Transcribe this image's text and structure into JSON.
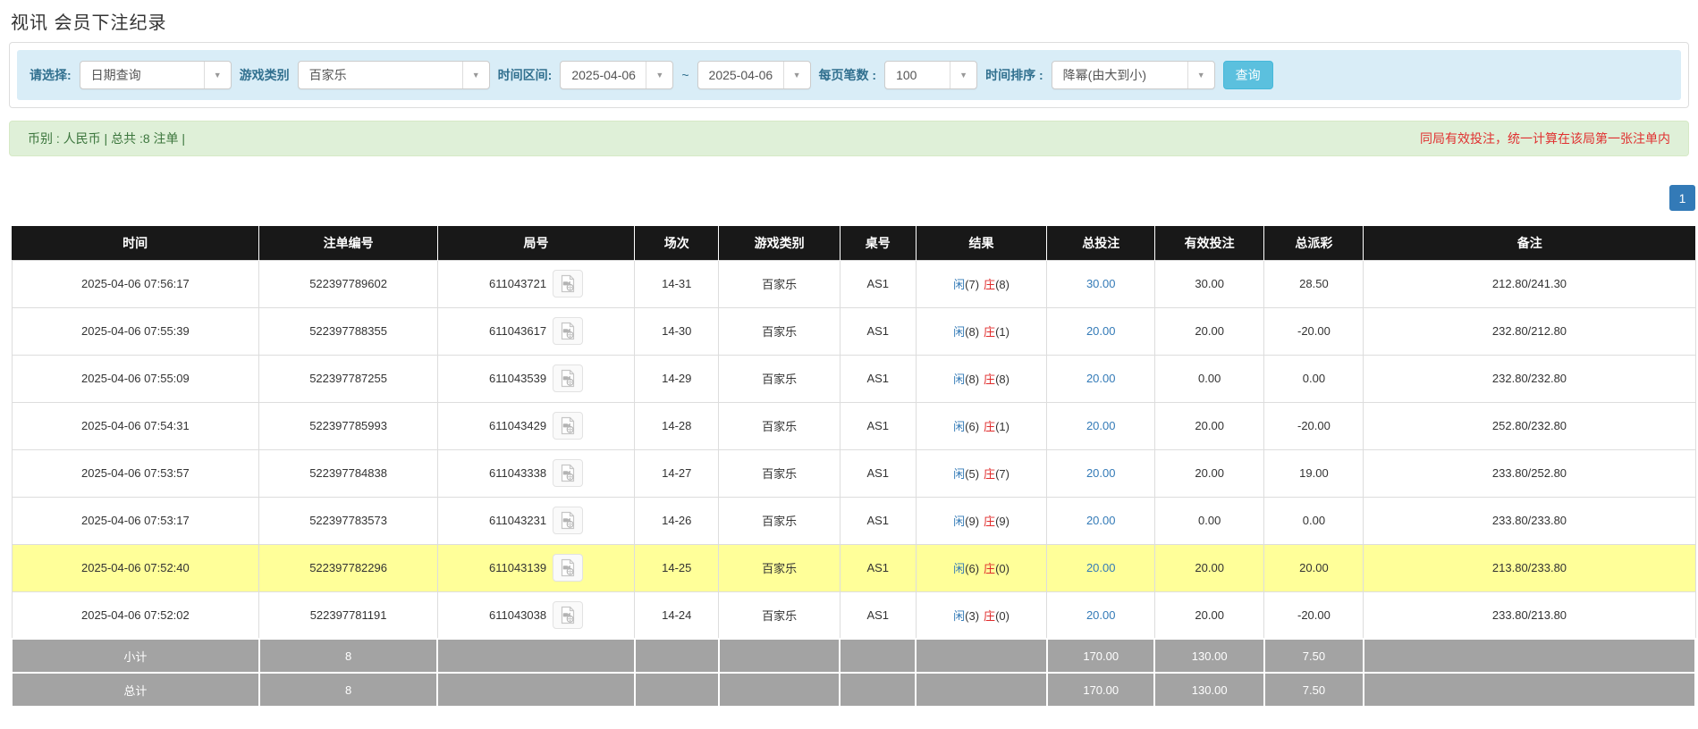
{
  "page_title": "视讯 会员下注纪录",
  "filters": {
    "query_type_label": "请选择:",
    "query_type_value": "日期查询",
    "game_type_label": "游戏类别",
    "game_type_value": "百家乐",
    "time_range_label": "时间区间:",
    "date_from": "2025-04-06",
    "tilde": "~",
    "date_to": "2025-04-06",
    "page_size_label": "每页笔数 :",
    "page_size_value": "100",
    "sort_label": "时间排序 :",
    "sort_value": "降幂(由大到小)",
    "search_button_label": "查询"
  },
  "summary_bar": {
    "left_text": "币别 : 人民币 | 总共 :8 注单 |",
    "right_text": "同局有效投注，统一计算在该局第一张注单内"
  },
  "pagination": {
    "current_page": "1"
  },
  "icons": {
    "dropdown_caret": "chevron-down-icon",
    "round_media": "video-replay-icon"
  },
  "colors": {
    "header_bg": "#181818",
    "filter_bar_bg": "#d9edf7",
    "filter_label": "#31708f",
    "summary_bg": "#dff0d8",
    "summary_text_green": "#3c763d",
    "warning_red": "#e03131",
    "link_blue": "#337ab7",
    "player_blue": "#337ab7",
    "banker_red": "#e02b2b",
    "negative_red": "#e60000",
    "highlight_yellow": "#ffff99",
    "footer_gray": "#a3a3a3",
    "search_button_bg": "#5bc0de",
    "pagination_active_bg": "#337ab7"
  },
  "table": {
    "columns": [
      "时间",
      "注单编号",
      "局号",
      "场次",
      "游戏类别",
      "桌号",
      "结果",
      "总投注",
      "有效投注",
      "总派彩",
      "备注"
    ],
    "result_labels": {
      "player": "闲",
      "banker": "庄"
    },
    "rows": [
      {
        "time": "2025-04-06 07:56:17",
        "bet_no": "522397789602",
        "round_no": "611043721",
        "session": "14-31",
        "game": "百家乐",
        "table_no": "AS1",
        "player_pts": "(7)",
        "banker_pts": "(8)",
        "total_bet": "30.00",
        "valid_bet": "30.00",
        "payout": "28.50",
        "remark": "212.80/241.30",
        "highlight": false
      },
      {
        "time": "2025-04-06 07:55:39",
        "bet_no": "522397788355",
        "round_no": "611043617",
        "session": "14-30",
        "game": "百家乐",
        "table_no": "AS1",
        "player_pts": "(8)",
        "banker_pts": "(1)",
        "total_bet": "20.00",
        "valid_bet": "20.00",
        "payout": "-20.00",
        "remark": "232.80/212.80",
        "highlight": false
      },
      {
        "time": "2025-04-06 07:55:09",
        "bet_no": "522397787255",
        "round_no": "611043539",
        "session": "14-29",
        "game": "百家乐",
        "table_no": "AS1",
        "player_pts": "(8)",
        "banker_pts": "(8)",
        "total_bet": "20.00",
        "valid_bet": "0.00",
        "payout": "0.00",
        "remark": "232.80/232.80",
        "highlight": false
      },
      {
        "time": "2025-04-06 07:54:31",
        "bet_no": "522397785993",
        "round_no": "611043429",
        "session": "14-28",
        "game": "百家乐",
        "table_no": "AS1",
        "player_pts": "(6)",
        "banker_pts": "(1)",
        "total_bet": "20.00",
        "valid_bet": "20.00",
        "payout": "-20.00",
        "remark": "252.80/232.80",
        "highlight": false
      },
      {
        "time": "2025-04-06 07:53:57",
        "bet_no": "522397784838",
        "round_no": "611043338",
        "session": "14-27",
        "game": "百家乐",
        "table_no": "AS1",
        "player_pts": "(5)",
        "banker_pts": "(7)",
        "total_bet": "20.00",
        "valid_bet": "20.00",
        "payout": "19.00",
        "remark": "233.80/252.80",
        "highlight": false
      },
      {
        "time": "2025-04-06 07:53:17",
        "bet_no": "522397783573",
        "round_no": "611043231",
        "session": "14-26",
        "game": "百家乐",
        "table_no": "AS1",
        "player_pts": "(9)",
        "banker_pts": "(9)",
        "total_bet": "20.00",
        "valid_bet": "0.00",
        "payout": "0.00",
        "remark": "233.80/233.80",
        "highlight": false
      },
      {
        "time": "2025-04-06 07:52:40",
        "bet_no": "522397782296",
        "round_no": "611043139",
        "session": "14-25",
        "game": "百家乐",
        "table_no": "AS1",
        "player_pts": "(6)",
        "banker_pts": "(0)",
        "total_bet": "20.00",
        "valid_bet": "20.00",
        "payout": "20.00",
        "remark": "213.80/233.80",
        "highlight": true
      },
      {
        "time": "2025-04-06 07:52:02",
        "bet_no": "522397781191",
        "round_no": "611043038",
        "session": "14-24",
        "game": "百家乐",
        "table_no": "AS1",
        "player_pts": "(3)",
        "banker_pts": "(0)",
        "total_bet": "20.00",
        "valid_bet": "20.00",
        "payout": "-20.00",
        "remark": "233.80/213.80",
        "highlight": false
      }
    ],
    "subtotal": {
      "label": "小计",
      "count": "8",
      "total_bet": "170.00",
      "valid_bet": "130.00",
      "payout": "7.50"
    },
    "total": {
      "label": "总计",
      "count": "8",
      "total_bet": "170.00",
      "valid_bet": "130.00",
      "payout": "7.50"
    }
  }
}
